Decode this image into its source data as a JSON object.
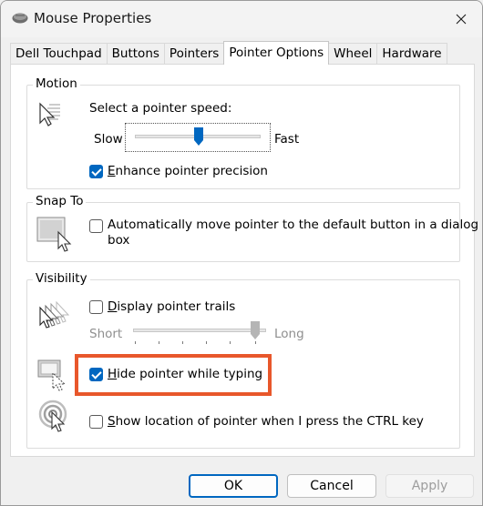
{
  "window": {
    "title": "Mouse Properties"
  },
  "tabs": [
    {
      "label": "Dell Touchpad"
    },
    {
      "label": "Buttons"
    },
    {
      "label": "Pointers"
    },
    {
      "label": "Pointer Options",
      "active": true
    },
    {
      "label": "Wheel"
    },
    {
      "label": "Hardware"
    }
  ],
  "motion": {
    "group_label": "Motion",
    "speed_label": "Select a pointer speed:",
    "slow_label": "Slow",
    "fast_label": "Fast",
    "speed_value": 0.5,
    "enhance_label": "Enhance pointer precision",
    "enhance_checked": true
  },
  "snap_to": {
    "group_label": "Snap To",
    "auto_label_line1": "Automatically move pointer to the default button in a dialog",
    "auto_label_line2": "box",
    "auto_checked": false
  },
  "visibility": {
    "group_label": "Visibility",
    "trails_label": "Display pointer trails",
    "trails_checked": false,
    "short_label": "Short",
    "long_label": "Long",
    "trails_value": 1.0,
    "hide_label": "Hide pointer while typing",
    "hide_checked": true,
    "show_location_label": "Show location of pointer when I press the CTRL key",
    "show_location_checked": false
  },
  "buttons": {
    "ok": "OK",
    "cancel": "Cancel",
    "apply": "Apply"
  },
  "colors": {
    "accent": "#0067c0",
    "highlight": "#e8572b"
  }
}
